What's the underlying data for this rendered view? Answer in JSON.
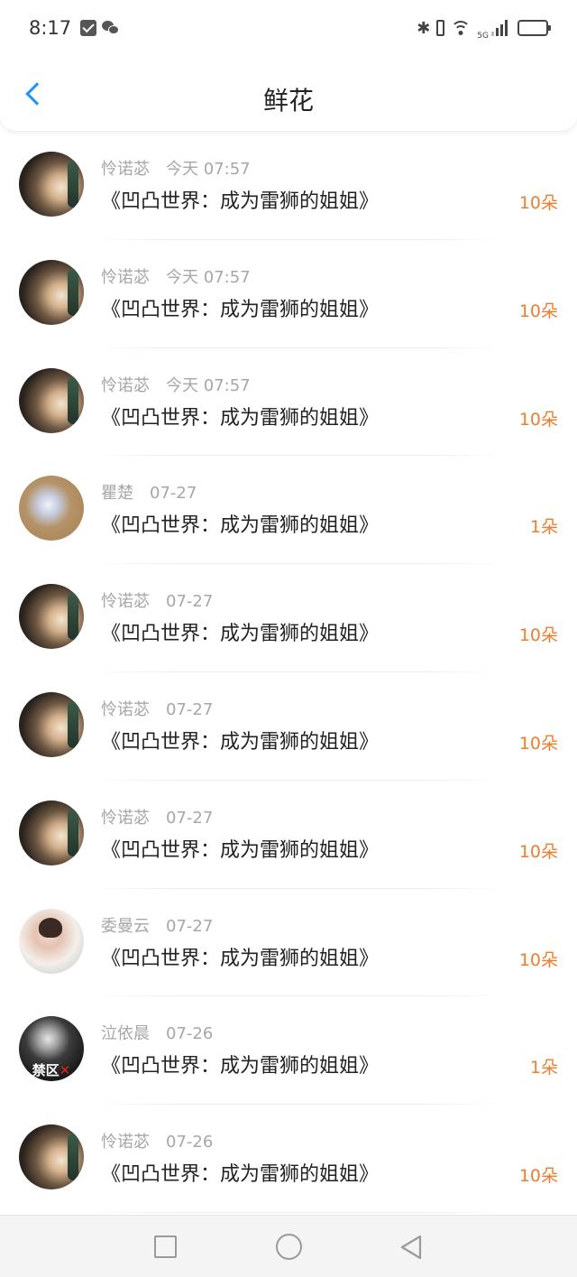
{
  "status_bar": {
    "time": "8:17",
    "left_icons": [
      "mail-icon",
      "wechat-icon"
    ],
    "right_icons": [
      "bluetooth-icon",
      "vibrate-icon",
      "wifi-icon",
      "5g-signal-icon",
      "battery-icon"
    ],
    "network_label": "5G",
    "battery_level": 0.85
  },
  "header": {
    "title": "鲜花",
    "back_icon": "chevron-left-icon",
    "accent_color": "#1e90ff"
  },
  "colors": {
    "count": "#ee7d2f",
    "meta": "#a7a7a7",
    "title": "#222222"
  },
  "items": [
    {
      "name": "怜诺苾",
      "time": "今天 07:57",
      "title": "《凹凸世界：成为雷狮的姐姐》",
      "count": "10朵",
      "avatar": "a-dark"
    },
    {
      "name": "怜诺苾",
      "time": "今天 07:57",
      "title": "《凹凸世界：成为雷狮的姐姐》",
      "count": "10朵",
      "avatar": "a-dark"
    },
    {
      "name": "怜诺苾",
      "time": "今天 07:57",
      "title": "《凹凸世界：成为雷狮的姐姐》",
      "count": "10朵",
      "avatar": "a-dark"
    },
    {
      "name": "瞿楚",
      "time": "07-27",
      "title": "《凹凸世界：成为雷狮的姐姐》",
      "count": "1朵",
      "avatar": "a-bright"
    },
    {
      "name": "怜诺苾",
      "time": "07-27",
      "title": "《凹凸世界：成为雷狮的姐姐》",
      "count": "10朵",
      "avatar": "a-dark"
    },
    {
      "name": "怜诺苾",
      "time": "07-27",
      "title": "《凹凸世界：成为雷狮的姐姐》",
      "count": "10朵",
      "avatar": "a-dark"
    },
    {
      "name": "怜诺苾",
      "time": "07-27",
      "title": "《凹凸世界：成为雷狮的姐姐》",
      "count": "10朵",
      "avatar": "a-dark"
    },
    {
      "name": "委曼云",
      "time": "07-27",
      "title": "《凹凸世界：成为雷狮的姐姐》",
      "count": "10朵",
      "avatar": "a-girl"
    },
    {
      "name": "泣依晨",
      "time": "07-26",
      "title": "《凹凸世界：成为雷狮的姐姐》",
      "count": "1朵",
      "avatar": "a-bw",
      "avatar_badge": "禁区"
    },
    {
      "name": "怜诺苾",
      "time": "07-26",
      "title": "《凹凸世界：成为雷狮的姐姐》",
      "count": "10朵",
      "avatar": "a-dark"
    }
  ],
  "nav_bar": {
    "buttons": [
      "recent-apps-icon",
      "home-icon",
      "back-triangle-icon"
    ]
  }
}
